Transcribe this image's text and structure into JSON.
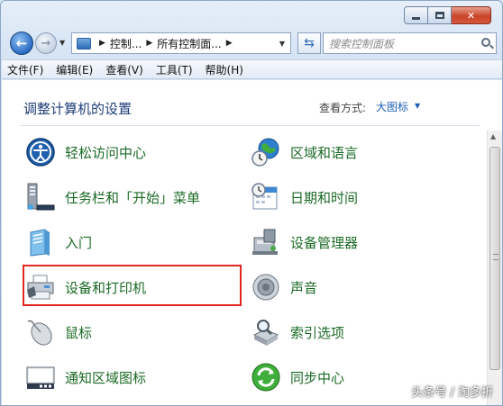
{
  "address": {
    "crumbs": [
      "控制...",
      "所有控制面..."
    ]
  },
  "search": {
    "placeholder": "搜索控制面板"
  },
  "menu": [
    "文件(F)",
    "编辑(E)",
    "查看(V)",
    "工具(T)",
    "帮助(H)"
  ],
  "content": {
    "title": "调整计算机的设置",
    "view_by_label": "查看方式:",
    "view_by_value": "大图标"
  },
  "items": [
    {
      "label": "轻松访问中心",
      "icon": "ease-of-access-icon"
    },
    {
      "label": "区域和语言",
      "icon": "globe-clock-icon"
    },
    {
      "label": "任务栏和「开始」菜单",
      "icon": "taskbar-icon"
    },
    {
      "label": "日期和时间",
      "icon": "calendar-clock-icon"
    },
    {
      "label": "入门",
      "icon": "getting-started-icon"
    },
    {
      "label": "设备管理器",
      "icon": "device-manager-icon"
    },
    {
      "label": "设备和打印机",
      "icon": "printer-icon"
    },
    {
      "label": "声音",
      "icon": "speaker-icon"
    },
    {
      "label": "鼠标",
      "icon": "mouse-icon"
    },
    {
      "label": "索引选项",
      "icon": "index-search-icon"
    },
    {
      "label": "通知区域图标",
      "icon": "notification-area-icon"
    },
    {
      "label": "同步中心",
      "icon": "sync-center-icon"
    }
  ],
  "watermark": "头条号 / 淘多折",
  "colors": {
    "highlight": "#e2261f",
    "link_green": "#1a6a25",
    "title_blue": "#1e3d78"
  }
}
